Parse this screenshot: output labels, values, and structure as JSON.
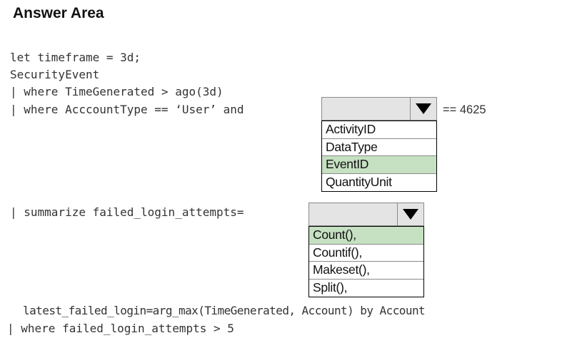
{
  "header": {
    "title": "Answer Area"
  },
  "code": {
    "line1": "let timeframe = 3d;",
    "line2": "SecurityEvent",
    "line3": "| where TimeGenerated > ago(3d)",
    "line4": "| where AcccountType == ‘User’ and",
    "line4_suffix": "== 4625",
    "line5": "| summarize failed_login_attempts=",
    "line6": "latest_failed_login=arg_max(TimeGenerated, Account) by Account",
    "line7": "| where failed_login_attempts > 5"
  },
  "dropdown1": {
    "icon": "chevron-down-icon",
    "options": [
      "ActivityID",
      "DataType",
      "EventID",
      "QuantityUnit"
    ],
    "highlighted": "EventID"
  },
  "dropdown2": {
    "icon": "chevron-down-icon",
    "options": [
      "Count(),",
      "Countif(),",
      "Makeset(),",
      "Split(),"
    ],
    "highlighted": "Count(),"
  },
  "colors": {
    "highlight": "#c6e0c2",
    "dropdown_bg": "#e4e4e4"
  }
}
